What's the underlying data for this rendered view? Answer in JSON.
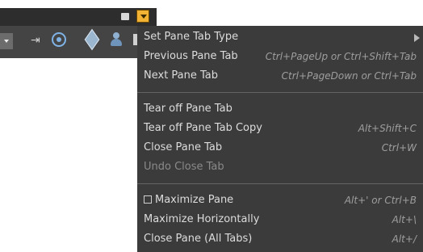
{
  "menu": {
    "groups": [
      {
        "items": [
          {
            "label": "Set Pane Tab Type",
            "shortcut": ""
          },
          {
            "label": "Previous Pane Tab",
            "shortcut": "Ctrl+PageUp or Ctrl+Shift+Tab"
          },
          {
            "label": "Next Pane Tab",
            "shortcut": "Ctrl+PageDown or Ctrl+Tab"
          }
        ]
      },
      {
        "items": [
          {
            "label": "Tear off Pane Tab",
            "shortcut": ""
          },
          {
            "label": "Tear off Pane Tab Copy",
            "shortcut": "Alt+Shift+C"
          },
          {
            "label": "Close Pane Tab",
            "shortcut": "Ctrl+W"
          },
          {
            "label": "Undo Close Tab",
            "shortcut": "",
            "disabled": true
          }
        ]
      },
      {
        "items": [
          {
            "label": "Maximize Pane",
            "shortcut": "Alt+' or Ctrl+B",
            "checkbox": true,
            "checked": false
          },
          {
            "label": "Maximize Horizontally",
            "shortcut": "Alt+\\"
          },
          {
            "label": "Close Pane (All Tabs)",
            "shortcut": "Alt+/"
          }
        ]
      }
    ]
  },
  "icons": {
    "pane_menu_button": "pane-menu-dropdown-icon",
    "pane_toggle": "pane-toggle-icon",
    "submenu_arrow": "submenu-arrow-icon"
  },
  "colors": {
    "menu_bg": "#3b3b3b",
    "menu_text": "#dcdcdc",
    "shortcut_text": "#9e9e9e",
    "disabled_text": "#8a8a8a",
    "accent": "#f2b233"
  }
}
